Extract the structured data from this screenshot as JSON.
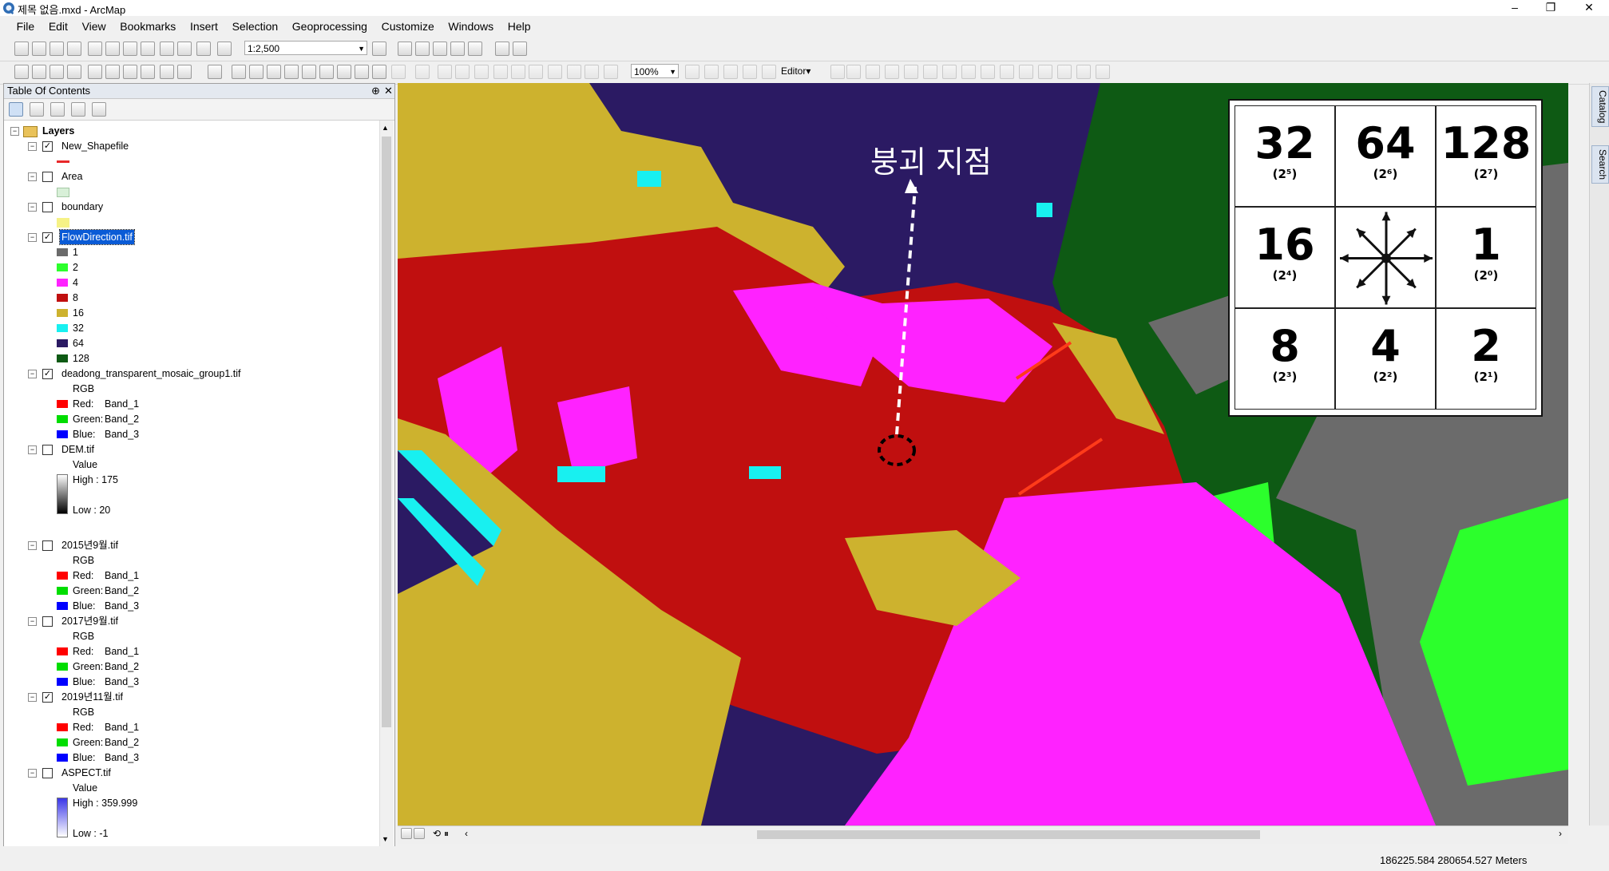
{
  "window": {
    "title": "제목 없음.mxd - ArcMap",
    "controls": [
      "–",
      "❐",
      "✕"
    ]
  },
  "menu": [
    "File",
    "Edit",
    "View",
    "Bookmarks",
    "Insert",
    "Selection",
    "Geoprocessing",
    "Customize",
    "Windows",
    "Help"
  ],
  "toolbar": {
    "scale_value": "1:2,500",
    "zoom_value": "100%",
    "editor_label": "Editor▾"
  },
  "toc": {
    "title": "Table Of Contents",
    "pin": "⊕",
    "close": "✕",
    "root": "Layers",
    "layers": [
      {
        "name": "New_Shapefile",
        "checked": true,
        "legend": [
          {
            "type": "line",
            "color": "#e8282a"
          }
        ]
      },
      {
        "name": "Area",
        "checked": false,
        "legend": [
          {
            "type": "fill",
            "color": "#d8f0d8",
            "border": "#a4c8a4"
          }
        ]
      },
      {
        "name": "boundary",
        "checked": false,
        "legend": [
          {
            "type": "fill",
            "color": "#f6f286"
          }
        ]
      },
      {
        "name": "FlowDirection.tif",
        "checked": true,
        "selected": true,
        "legend": [
          {
            "type": "class",
            "label": "1",
            "color": "#6b6b6b"
          },
          {
            "type": "class",
            "label": "2",
            "color": "#2cff2c"
          },
          {
            "type": "class",
            "label": "4",
            "color": "#ff22ff"
          },
          {
            "type": "class",
            "label": "8",
            "color": "#c00f0f"
          },
          {
            "type": "class",
            "label": "16",
            "color": "#cdb22e"
          },
          {
            "type": "class",
            "label": "32",
            "color": "#18f0f0"
          },
          {
            "type": "class",
            "label": "64",
            "color": "#2b1a63"
          },
          {
            "type": "class",
            "label": "128",
            "color": "#0e5a14"
          }
        ]
      },
      {
        "name": "deadong_transparent_mosaic_group1.tif",
        "checked": true,
        "legend": [
          {
            "type": "text",
            "label": "RGB"
          },
          {
            "type": "band",
            "channel": "Red:",
            "band": "Band_1",
            "color": "#ff0000"
          },
          {
            "type": "band",
            "channel": "Green:",
            "band": "Band_2",
            "color": "#00dd00"
          },
          {
            "type": "band",
            "channel": "Blue:",
            "band": "Band_3",
            "color": "#0000ff"
          }
        ]
      },
      {
        "name": "DEM.tif",
        "checked": false,
        "legend": [
          {
            "type": "text",
            "label": "Value"
          },
          {
            "type": "ramp",
            "high": "High : 175",
            "low": "Low : 20",
            "from": "#ffffff",
            "to": "#000000"
          }
        ]
      },
      {
        "name": "2015년9월.tif",
        "checked": false,
        "legend": [
          {
            "type": "text",
            "label": "RGB"
          },
          {
            "type": "band",
            "channel": "Red:",
            "band": "Band_1",
            "color": "#ff0000"
          },
          {
            "type": "band",
            "channel": "Green:",
            "band": "Band_2",
            "color": "#00dd00"
          },
          {
            "type": "band",
            "channel": "Blue:",
            "band": "Band_3",
            "color": "#0000ff"
          }
        ]
      },
      {
        "name": "2017년9월.tif",
        "checked": false,
        "legend": [
          {
            "type": "text",
            "label": "RGB"
          },
          {
            "type": "band",
            "channel": "Red:",
            "band": "Band_1",
            "color": "#ff0000"
          },
          {
            "type": "band",
            "channel": "Green:",
            "band": "Band_2",
            "color": "#00dd00"
          },
          {
            "type": "band",
            "channel": "Blue:",
            "band": "Band_3",
            "color": "#0000ff"
          }
        ]
      },
      {
        "name": "2019년11월.tif",
        "checked": true,
        "legend": [
          {
            "type": "text",
            "label": "RGB"
          },
          {
            "type": "band",
            "channel": "Red:",
            "band": "Band_1",
            "color": "#ff0000"
          },
          {
            "type": "band",
            "channel": "Green:",
            "band": "Band_2",
            "color": "#00dd00"
          },
          {
            "type": "band",
            "channel": "Blue:",
            "band": "Band_3",
            "color": "#0000ff"
          }
        ]
      },
      {
        "name": "ASPECT.tif",
        "checked": false,
        "legend": [
          {
            "type": "text",
            "label": "Value"
          },
          {
            "type": "ramp",
            "high": "High : 359.999",
            "low": "Low : -1",
            "from": "#3a36e8",
            "to": "#ffffff"
          }
        ]
      }
    ]
  },
  "map": {
    "annotation": "붕괴 지점",
    "colors": {
      "dark_purple": "#2b1a63",
      "red": "#c00f0f",
      "gold": "#cdb22e",
      "magenta": "#ff22ff",
      "cyan": "#18f0f0",
      "dark_green": "#0e5a14",
      "gray": "#6b6b6b",
      "green": "#2cff2c"
    },
    "legend_grid": [
      {
        "value": "32",
        "power": "(2⁵)"
      },
      {
        "value": "64",
        "power": "(2⁶)"
      },
      {
        "value": "128",
        "power": "(2⁷)"
      },
      {
        "value": "16",
        "power": "(2⁴)"
      },
      {
        "value": "",
        "power": ""
      },
      {
        "value": "1",
        "power": "(2⁰)"
      },
      {
        "value": "8",
        "power": "(2³)"
      },
      {
        "value": "4",
        "power": "(2²)"
      },
      {
        "value": "2",
        "power": "(2¹)"
      }
    ]
  },
  "right_rail": {
    "catalog": "Catalog",
    "search": "Search"
  },
  "status": {
    "coordinates": "186225.584  280654.527 Meters"
  }
}
